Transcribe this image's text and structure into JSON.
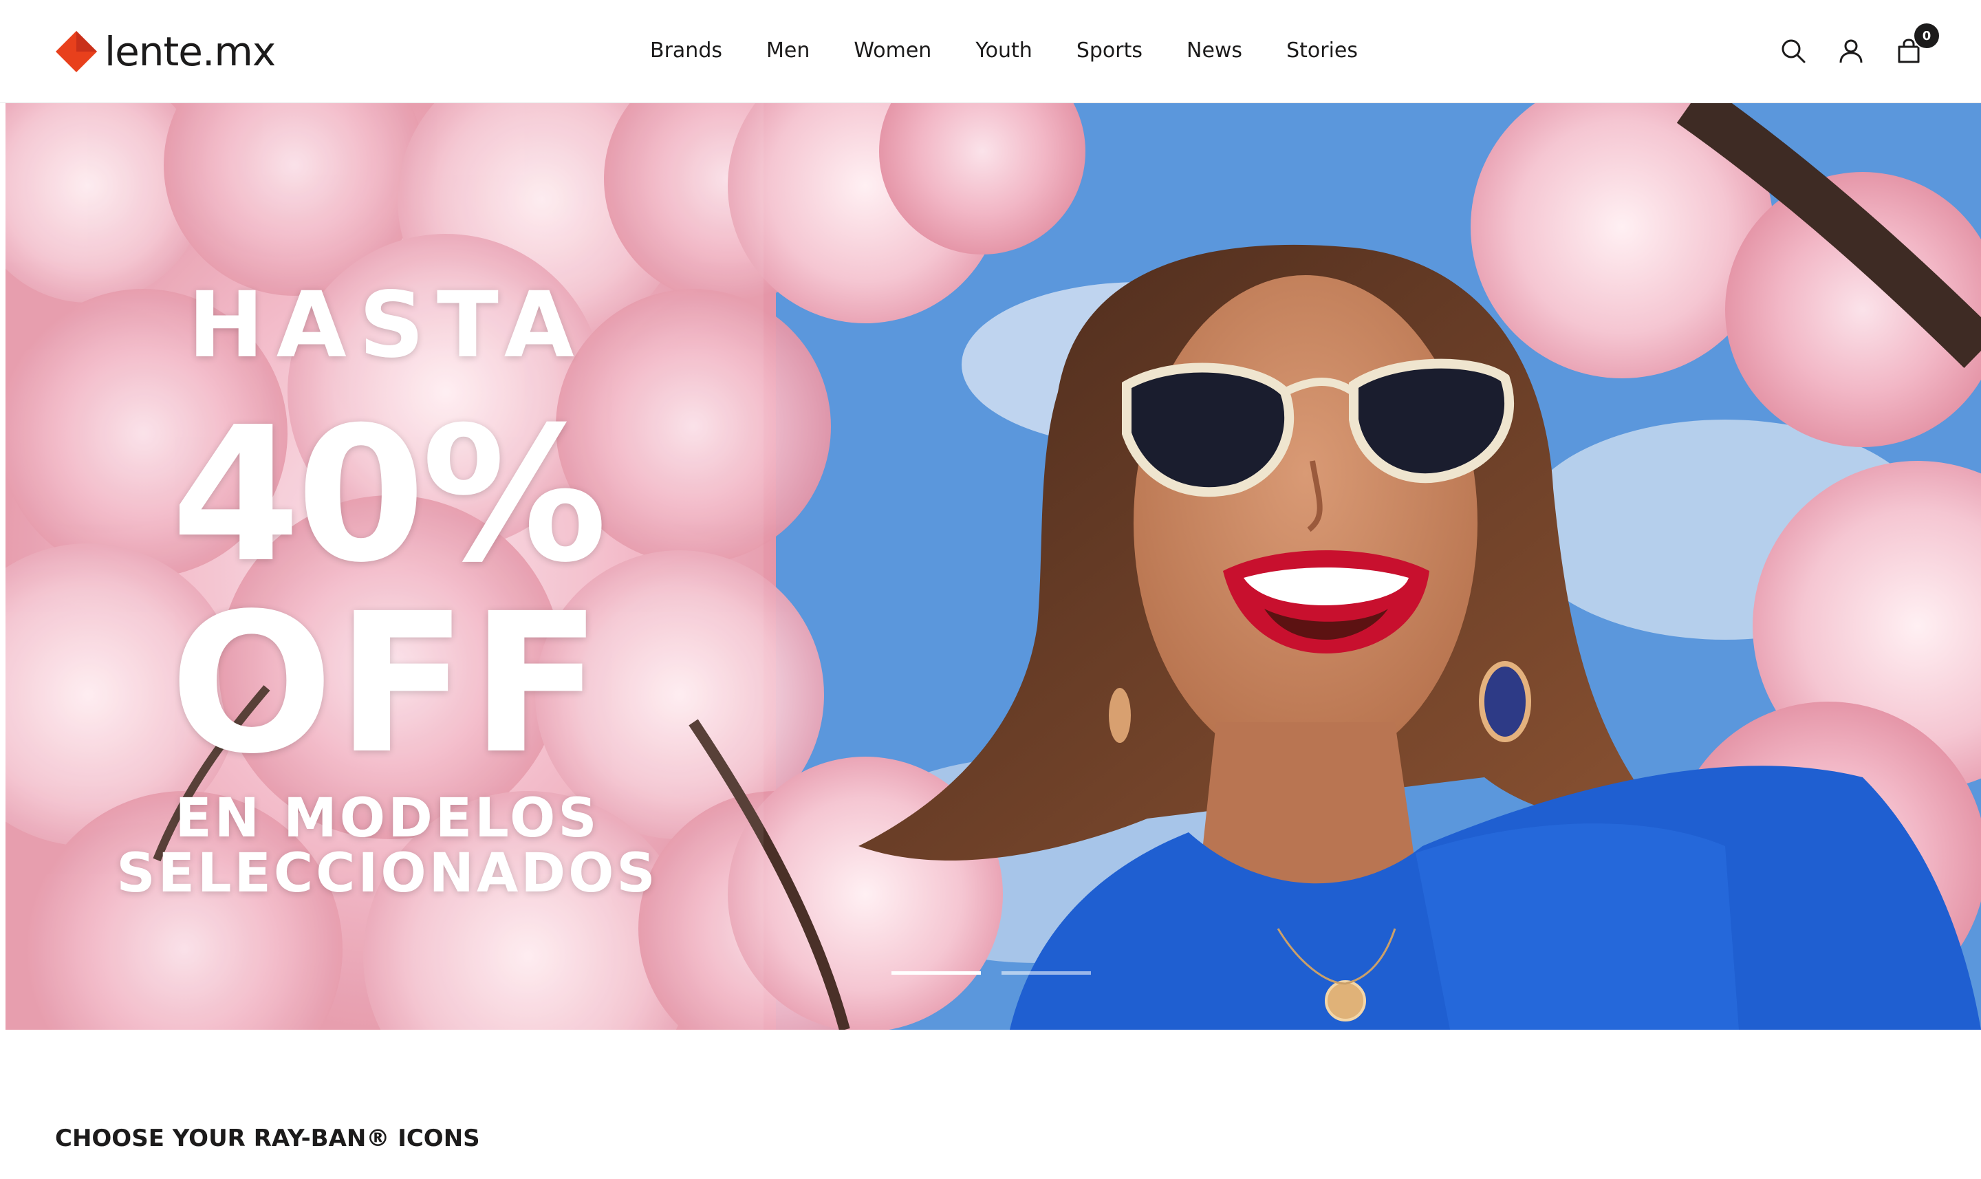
{
  "brand": {
    "name": "lente.mx",
    "accent_color": "#e8401c"
  },
  "nav": {
    "items": [
      {
        "label": "Brands"
      },
      {
        "label": "Men"
      },
      {
        "label": "Women"
      },
      {
        "label": "Youth"
      },
      {
        "label": "Sports"
      },
      {
        "label": "News"
      },
      {
        "label": "Stories"
      }
    ]
  },
  "header_icons": {
    "search": "search-icon",
    "account": "user-icon",
    "cart": "shopping-bag-icon",
    "cart_count": "0"
  },
  "hero": {
    "line1": "HASTA",
    "line2": "40%",
    "line3": "OFF",
    "line4": "EN MODELOS",
    "line5": "SELECCIONADOS",
    "slides_total": 2,
    "active_slide": 1
  },
  "section": {
    "title": "CHOOSE YOUR RAY-BAN® ICONS"
  }
}
